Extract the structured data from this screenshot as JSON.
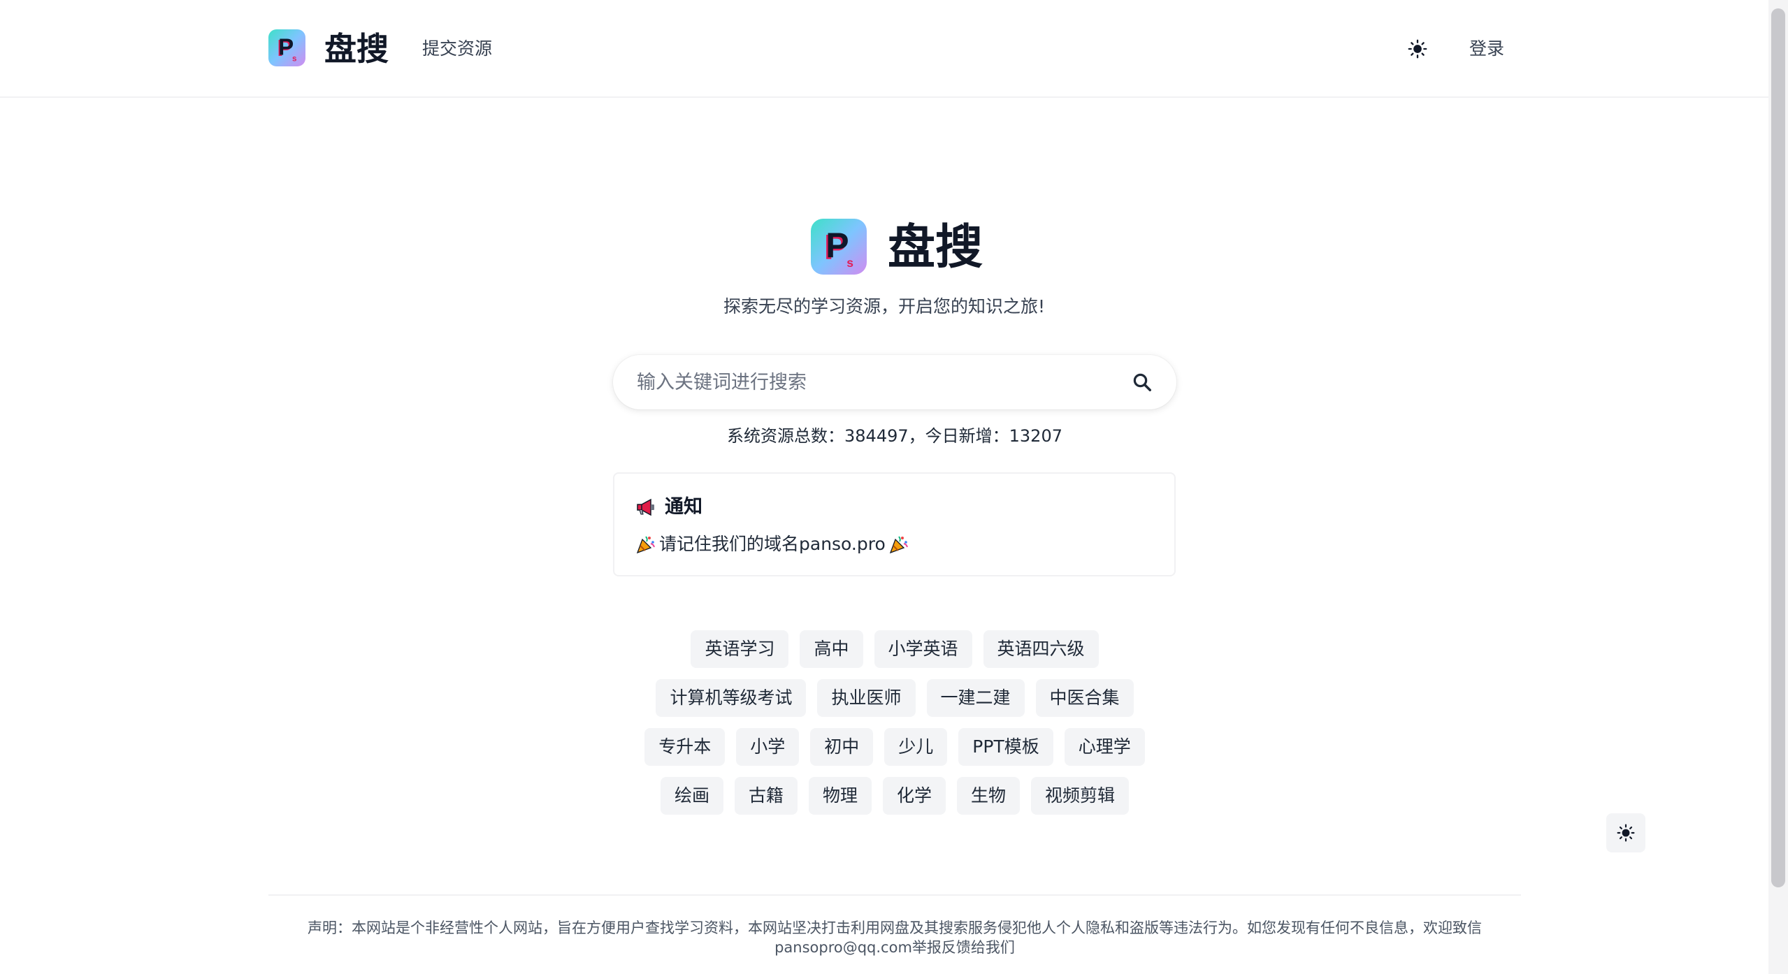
{
  "header": {
    "brand": "盘搜",
    "submit_label": "提交资源",
    "login_label": "登录"
  },
  "hero": {
    "brand": "盘搜",
    "tagline": "探索无尽的学习资源，开启您的知识之旅!"
  },
  "search": {
    "placeholder": "输入关键词进行搜索",
    "value": ""
  },
  "stats": {
    "text": "系统资源总数：384497，今日新增：13207"
  },
  "notice": {
    "title": "通知",
    "message": "请记住我们的域名panso.pro"
  },
  "tags": {
    "row1": [
      "英语学习",
      "高中",
      "小学英语",
      "英语四六级"
    ],
    "row2": [
      "计算机等级考试",
      "执业医师",
      "一建二建",
      "中医合集"
    ],
    "row3": [
      "专升本",
      "小学",
      "初中",
      "少儿",
      "PPT模板",
      "心理学"
    ],
    "row4": [
      "绘画",
      "古籍",
      "物理",
      "化学",
      "生物",
      "视频剪辑"
    ]
  },
  "footer": {
    "disclaimer_line1": "声明：本网站是个非经营性个人网站，旨在方便用户查找学习资料，本网站坚决打击利用网盘及其搜索服务侵犯他人个人隐私和盗版等违法行为。如您发现有任何不良信息，欢迎致信",
    "disclaimer_line2": "pansopro@qq.com举报反馈给我们"
  },
  "icons": {
    "logo": "panso-logo-icon",
    "theme": "sun-icon",
    "search": "search-icon",
    "megaphone": "megaphone-icon",
    "party": "party-popper-icon"
  },
  "colors": {
    "text": "#1f2937",
    "tag_bg": "#f3f4f6",
    "border": "#f1f1f3"
  }
}
